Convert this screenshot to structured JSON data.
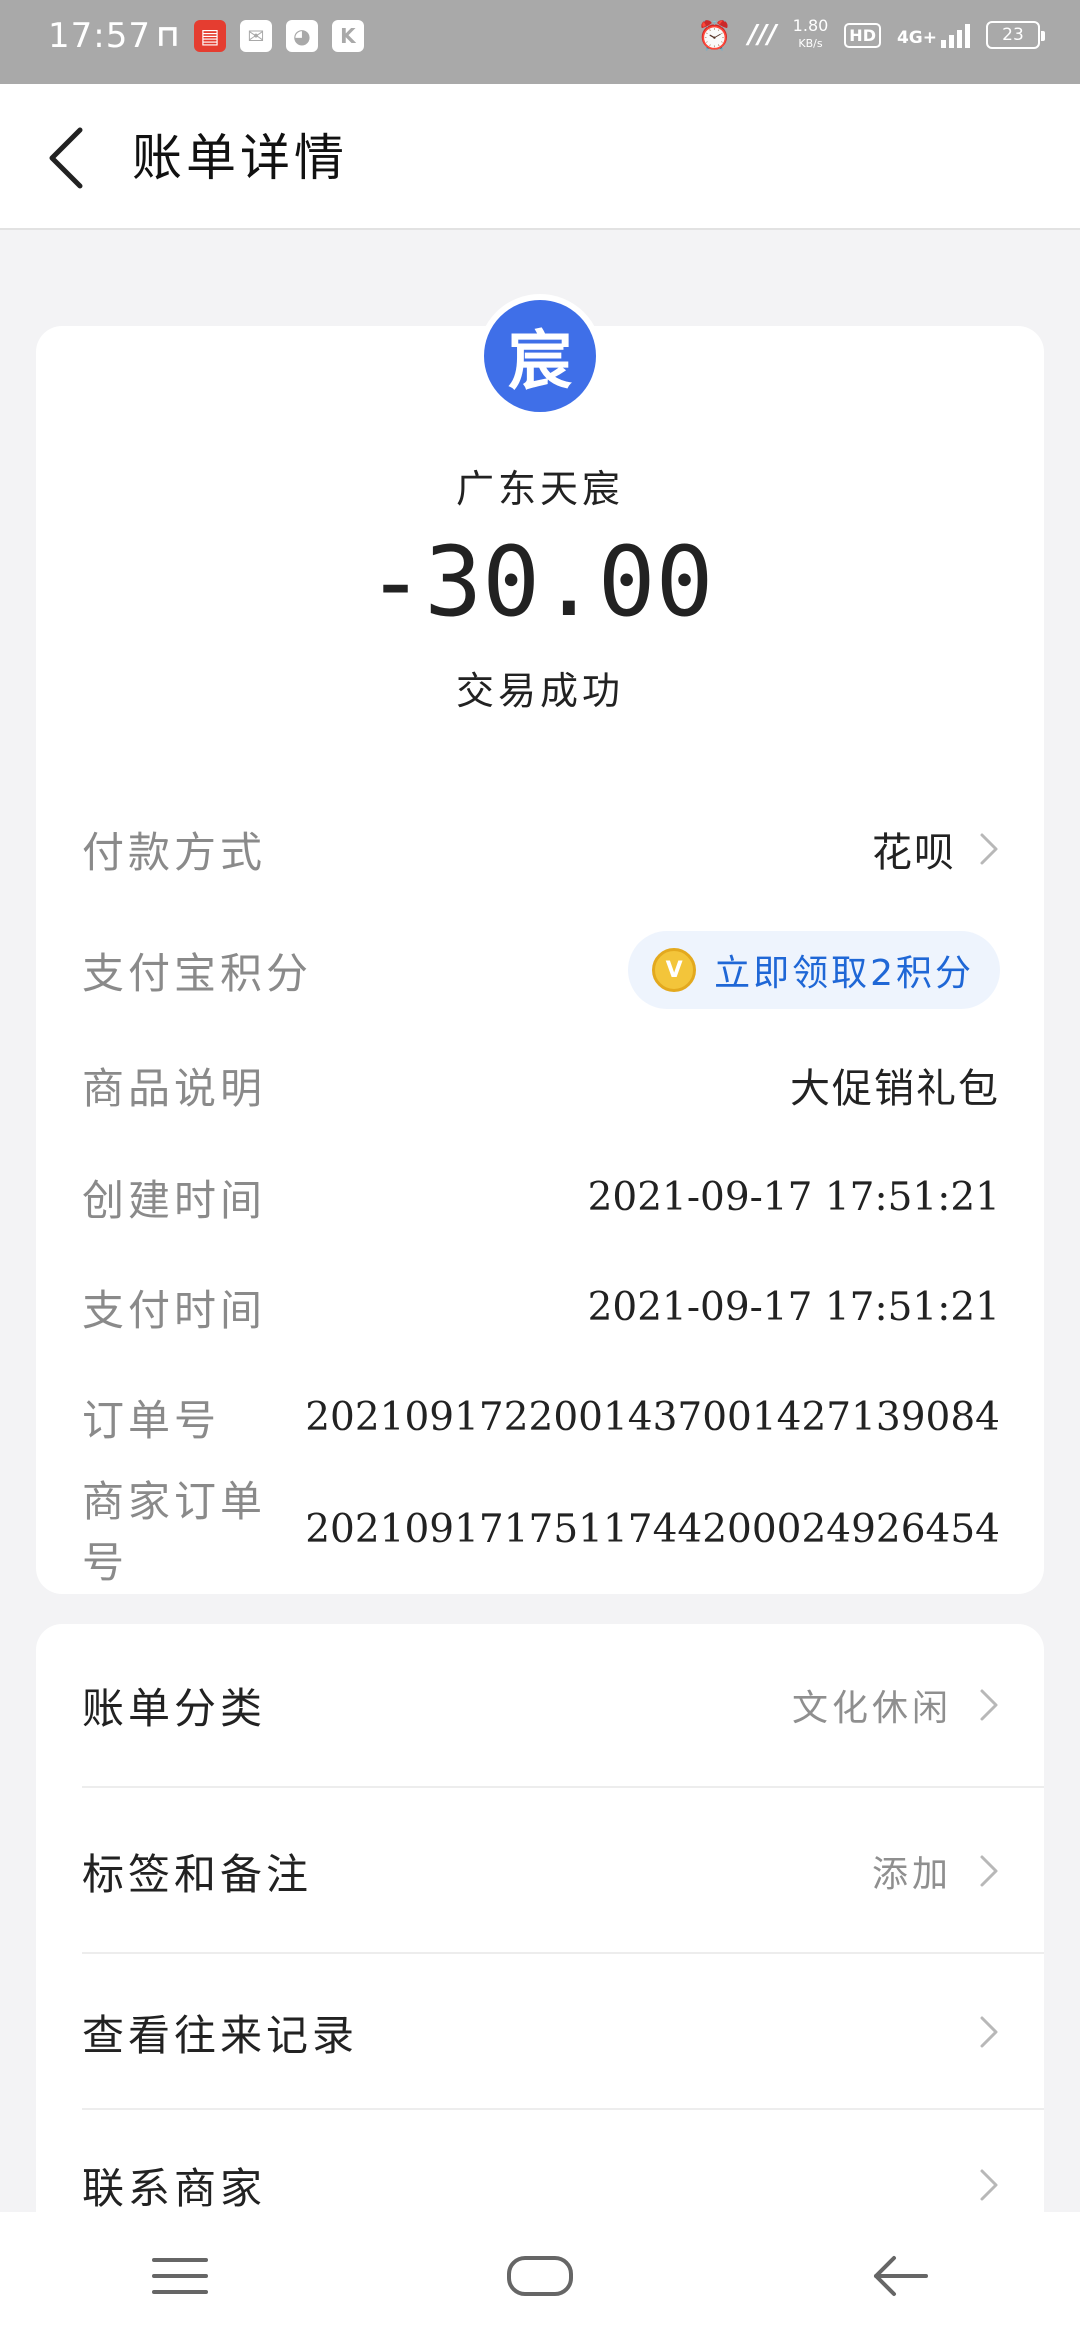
{
  "status_bar": {
    "time": "17:57",
    "speed_value": "1.80",
    "speed_unit": "KB/s",
    "hd_label": "HD",
    "network_label": "4G+",
    "battery": "23"
  },
  "header": {
    "title": "账单详情"
  },
  "summary": {
    "avatar_char": "宸",
    "avatar_color": "#3f6fe8",
    "merchant": "广东天宸",
    "amount": "-30.00",
    "status": "交易成功"
  },
  "details": {
    "payment_method_label": "付款方式",
    "payment_method_value": "花呗",
    "points_label": "支付宝积分",
    "points_value": "立即领取2积分",
    "product_label": "商品说明",
    "product_value": "大促销礼包",
    "created_label": "创建时间",
    "created_value": "2021-09-17 17:51:21",
    "paid_label": "支付时间",
    "paid_value": "2021-09-17 17:51:21",
    "order_label": "订单号",
    "order_value": "2021091722001437001427139084",
    "merchant_order_label": "商家订单号",
    "merchant_order_value": "2021091717511744200024926454"
  },
  "menu": {
    "category_label": "账单分类",
    "category_value": "文化休闲",
    "tags_label": "标签和备注",
    "tags_value": "添加",
    "history_label": "查看往来记录",
    "contact_label": "联系商家"
  },
  "colors": {
    "accent_blue": "#1f67d6",
    "status_bar_bg": "#a9a9a9"
  }
}
